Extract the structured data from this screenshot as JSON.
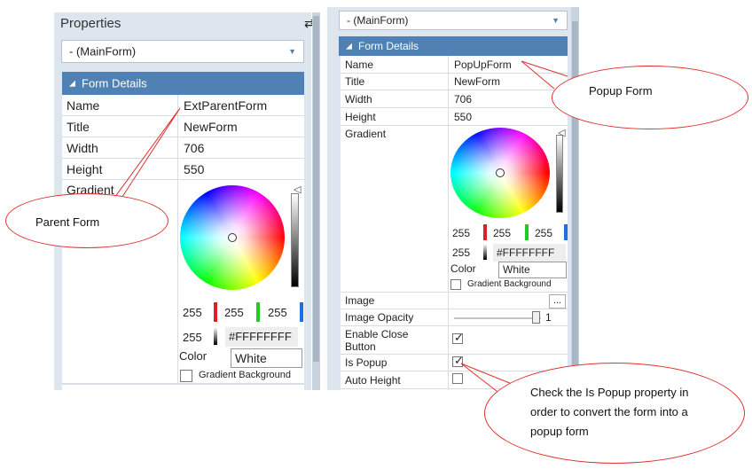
{
  "left_panel": {
    "title": "Properties",
    "pin_icon": "double-arrow-icon",
    "dropdown_value": "- (MainForm)",
    "section_label": "Form Details",
    "rows": [
      {
        "name": "Name",
        "value": "ExtParentForm"
      },
      {
        "name": "Title",
        "value": "NewForm"
      },
      {
        "name": "Width",
        "value": "706"
      },
      {
        "name": "Height",
        "value": "550"
      },
      {
        "name": "Gradient",
        "value": ""
      }
    ],
    "gradient": {
      "r": "255",
      "g": "255",
      "b": "255",
      "alpha": "255",
      "hex": "#FFFFFFFF",
      "color_label": "Color",
      "color_value": "White",
      "gradient_bg_label": "Gradient Background"
    }
  },
  "right_panel": {
    "dropdown_value": "- (MainForm)",
    "section_label": "Form Details",
    "rows": [
      {
        "name": "Name",
        "value": "PopUpForm"
      },
      {
        "name": "Title",
        "value": "NewForm"
      },
      {
        "name": "Width",
        "value": "706"
      },
      {
        "name": "Height",
        "value": "550"
      },
      {
        "name": "Gradient",
        "value": ""
      }
    ],
    "gradient": {
      "r": "255",
      "g": "255",
      "b": "255",
      "alpha": "255",
      "hex": "#FFFFFFFF",
      "color_label": "Color",
      "color_value": "White",
      "gradient_bg_label": "Gradient Background"
    },
    "image_label": "Image",
    "image_button": "...",
    "image_opacity_label": "Image Opacity",
    "image_opacity_value": "1",
    "enable_close_label": "Enable Close Button",
    "enable_close_checked": true,
    "is_popup_label": "Is Popup",
    "is_popup_checked": true,
    "auto_height_label": "Auto Height",
    "auto_height_checked": false
  },
  "callouts": {
    "parent_form": "Parent Form",
    "popup_form": "Popup Form",
    "is_popup_note": "Check the Is Popup property in order to convert the form into a popup  form"
  },
  "colors": {
    "accent": "#4f81b4",
    "panel_bg": "#dde6ef",
    "callout_border": "#e03030",
    "red": "#e02020",
    "green": "#22cc22",
    "blue": "#1e6fe0"
  }
}
